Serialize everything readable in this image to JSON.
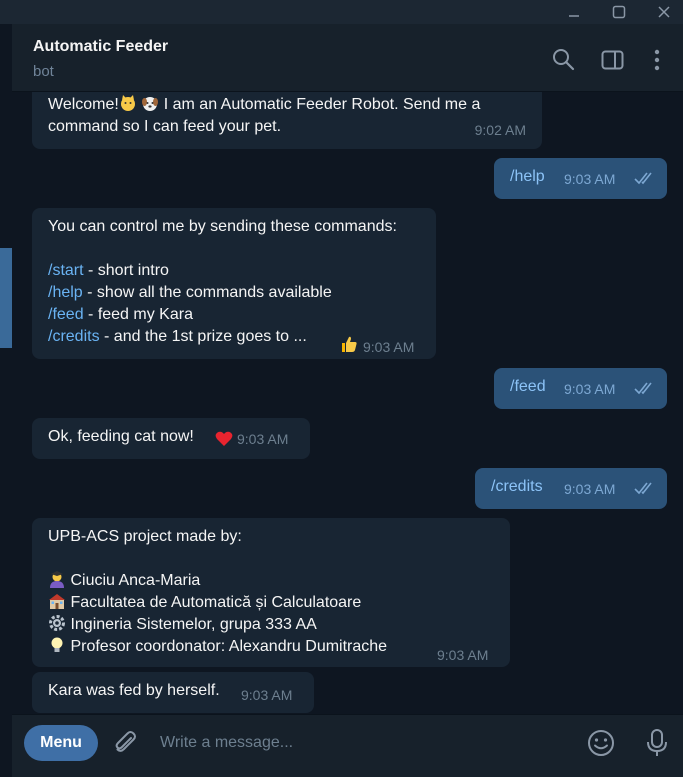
{
  "window": {
    "minimize_icon": "minimize-icon",
    "maximize_icon": "maximize-icon",
    "close_icon": "close-icon"
  },
  "header": {
    "title": "Automatic Feeder",
    "subtitle": "bot"
  },
  "messages": {
    "welcome": {
      "text_before": "Welcome!",
      "text_after": " I am an Automatic Feeder Robot. Send me a",
      "text_line2": "command so I can feed your pet.",
      "time": "9:02 AM"
    },
    "help_out": {
      "text": "/help",
      "time": "9:03 AM"
    },
    "help_reply": {
      "intro": "You can control me by sending these commands:",
      "commands": [
        {
          "cmd": "/start",
          "desc": " - short intro"
        },
        {
          "cmd": "/help",
          "desc": " - show all the commands available"
        },
        {
          "cmd": "/feed",
          "desc": " - feed my Kara"
        },
        {
          "cmd": "/credits",
          "desc": " - and the 1st prize goes to ..."
        }
      ],
      "time": "9:03 AM"
    },
    "feed_out": {
      "text": "/feed",
      "time": "9:03 AM"
    },
    "feeding": {
      "text": "Ok, feeding cat now!",
      "time": "9:03 AM"
    },
    "credits_out": {
      "text": "/credits",
      "time": "9:03 AM"
    },
    "credits_reply": {
      "intro": "UPB-ACS project made by:",
      "lines": [
        {
          "icon": "student-icon",
          "text": "Ciuciu Anca-Maria"
        },
        {
          "icon": "school-building-icon",
          "text": "Facultatea de Automatică și Calculatoare"
        },
        {
          "icon": "gear-icon",
          "text": "Ingineria Sistemelor, grupa 333 AA"
        },
        {
          "icon": "lightbulb-icon",
          "text": "Profesor coordonator: Alexandru Dumitrache"
        }
      ],
      "time": "9:03 AM"
    },
    "fed": {
      "text": "Kara was fed by herself.",
      "time": "9:03 AM"
    }
  },
  "composer": {
    "menu_label": "Menu",
    "placeholder": "Write a message..."
  },
  "colors": {
    "background": "#0e1621",
    "incoming_bubble": "#182533",
    "outgoing_bubble": "#2b5278",
    "link": "#6ab3f3",
    "menu_button": "#3f6fa6"
  }
}
